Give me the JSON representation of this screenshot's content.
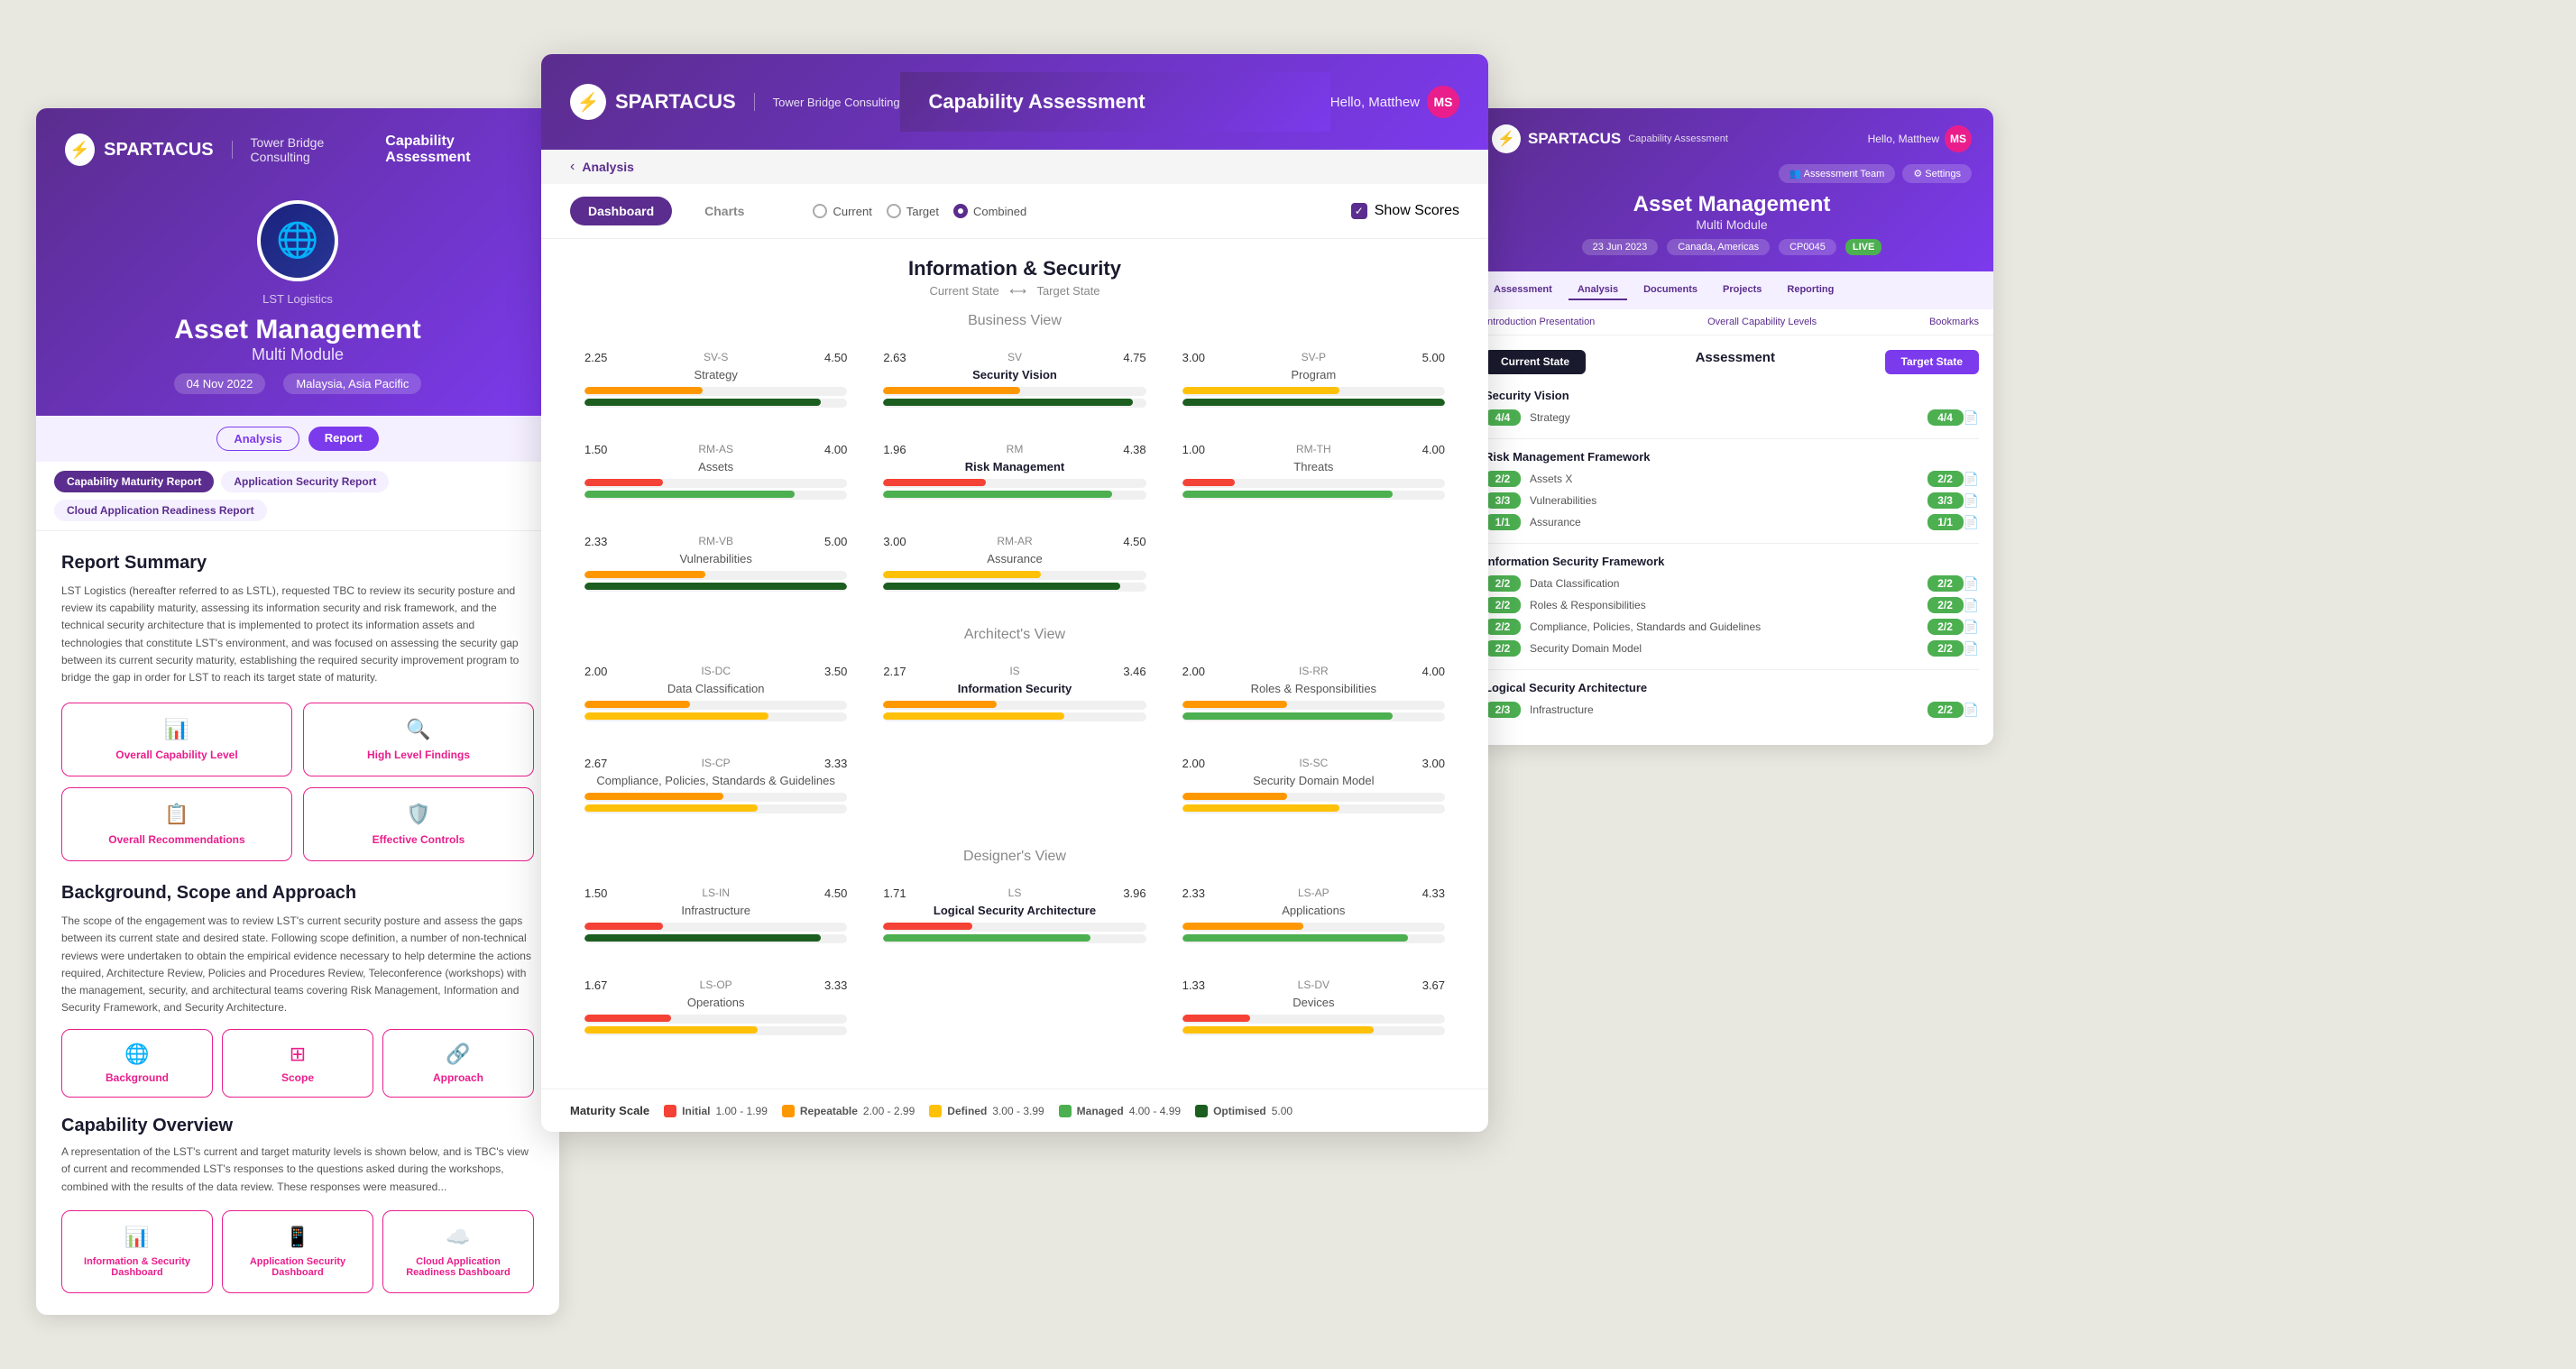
{
  "app": {
    "name": "SPARTACUS",
    "tower_bridge": "Tower Bridge Consulting",
    "cap_assessment": "Capability Assessment",
    "hello": "Hello, Matthew",
    "avatar_initials": "MS"
  },
  "left_panel": {
    "company": "LST Logistics",
    "title": "Asset Management",
    "subtitle": "Multi Module",
    "date": "04 Nov 2022",
    "region": "Malaysia, Asia Pacific",
    "nav": {
      "analysis": "Analysis",
      "report": "Report"
    },
    "tabs": [
      "Capability Maturity Report",
      "Application Security Report",
      "Cloud Application Readiness Report"
    ],
    "report_summary": {
      "title": "Report Summary",
      "text": "LST Logistics (hereafter referred to as LSTL), requested TBC to review its security posture and review its capability maturity, assessing its information security and risk framework, and the technical security architecture that is implemented to protect its information assets and technologies that constitute LST's environment, and was focused on assessing the security gap between its current security maturity, establishing the required security improvement program to bridge the gap in order for LST to reach its target state of maturity."
    },
    "quick_links": [
      {
        "label": "Overall Capability Level",
        "icon": "📊"
      },
      {
        "label": "High Level Findings",
        "icon": "🔍"
      },
      {
        "label": "Overall Recommendations",
        "icon": "📋"
      },
      {
        "label": "Effective Controls",
        "icon": "🛡️"
      }
    ],
    "bg_scope": {
      "title": "Background, Scope and Approach",
      "text": "The scope of the engagement was to review LST's current security posture and assess the gaps between its current state and desired state. Following scope definition, a number of non-technical reviews were undertaken to obtain the empirical evidence necessary to help determine the actions required, Architecture Review, Policies and Procedures Review, Teleconference (workshops) with the management, security, and architectural teams covering Risk Management, Information and Security Framework, and Security Architecture.",
      "links": [
        {
          "label": "Background",
          "icon": "🌐"
        },
        {
          "label": "Scope",
          "icon": "⊞"
        },
        {
          "label": "Approach",
          "icon": "🔗"
        }
      ]
    },
    "capability_overview": {
      "title": "Capability Overview",
      "text": "A representation of the LST's current and target maturity levels is shown below, and is TBC's view of current and recommended LST's responses to the questions asked during the workshops, combined with the results of the data review. These responses were measured...",
      "dash_links": [
        {
          "label": "Information & Security Dashboard",
          "icon": "📊"
        },
        {
          "label": "Application Security Dashboard",
          "icon": "📱"
        },
        {
          "label": "Cloud Application Readiness Dashboard",
          "icon": "☁️"
        }
      ]
    }
  },
  "center_panel": {
    "back_link": "Analysis",
    "tabs": [
      "Dashboard",
      "Charts"
    ],
    "radio_options": [
      "Current",
      "Target",
      "Combined"
    ],
    "selected_radio": "Combined",
    "show_scores_label": "Show Scores",
    "main_title": "Information & Security",
    "main_subtitle_current": "Current State",
    "main_subtitle_target": "Target State",
    "views": [
      {
        "title": "Business View",
        "metrics": [
          {
            "id": "sv-s",
            "label": "SV-S",
            "sublabel": "Strategy",
            "current": 2.25,
            "target": 4.5,
            "current_pct": 45,
            "target_pct": 90,
            "current_color": "orange",
            "target_color": "dark-green"
          },
          {
            "id": "sv",
            "label": "SV",
            "sublabel": "Security Vision",
            "current": 2.63,
            "target": 4.75,
            "current_pct": 52,
            "target_pct": 95,
            "current_color": "orange",
            "target_color": "dark-green",
            "bold": true
          },
          {
            "id": "sv-p",
            "label": "SV-P",
            "sublabel": "Program",
            "current": 3.0,
            "target": 5.0,
            "current_pct": 60,
            "target_pct": 100,
            "current_color": "yellow",
            "target_color": "dark-green"
          },
          {
            "id": "rm-as",
            "label": "RM-AS",
            "sublabel": "Assets",
            "current": 1.5,
            "target": 4.0,
            "current_pct": 30,
            "target_pct": 80,
            "current_color": "red",
            "target_color": "green"
          },
          {
            "id": "rm",
            "label": "RM",
            "sublabel": "Risk Management",
            "current": 1.96,
            "target": 4.38,
            "current_pct": 39,
            "target_pct": 87,
            "current_color": "red",
            "target_color": "green",
            "bold": true
          },
          {
            "id": "rm-th",
            "label": "RM-TH",
            "sublabel": "Threats",
            "current": 1.0,
            "target": 4.0,
            "current_pct": 20,
            "target_pct": 80,
            "current_color": "red",
            "target_color": "green"
          },
          {
            "id": "rm-vb",
            "label": "RM-VB",
            "sublabel": "Vulnerabilities",
            "current": 2.33,
            "target": 5.0,
            "current_pct": 46,
            "target_pct": 100,
            "current_color": "orange",
            "target_color": "dark-green"
          },
          {
            "id": "rm-ar",
            "label": "RM-AR",
            "sublabel": "Assurance",
            "current": 3.0,
            "target": 4.5,
            "current_pct": 60,
            "target_pct": 90,
            "current_color": "yellow",
            "target_color": "dark-green"
          }
        ]
      },
      {
        "title": "Architect's View",
        "metrics": [
          {
            "id": "is-dc",
            "label": "IS-DC",
            "sublabel": "Data Classification",
            "current": 2.0,
            "target": 3.5,
            "current_pct": 40,
            "target_pct": 70,
            "current_color": "orange",
            "target_color": "yellow"
          },
          {
            "id": "is",
            "label": "IS",
            "sublabel": "Information Security",
            "current": 2.17,
            "target": 3.46,
            "current_pct": 43,
            "target_pct": 69,
            "current_color": "orange",
            "target_color": "yellow",
            "bold": true
          },
          {
            "id": "is-rr",
            "label": "IS-RR",
            "sublabel": "Roles & Responsibilities",
            "current": 2.0,
            "target": 4.0,
            "current_pct": 40,
            "target_pct": 80,
            "current_color": "orange",
            "target_color": "green"
          },
          {
            "id": "is-cp",
            "label": "IS-CP",
            "sublabel": "Compliance, Policies, Standards & Guidelines",
            "current": 2.67,
            "target": 3.33,
            "current_pct": 53,
            "target_pct": 66,
            "current_color": "orange",
            "target_color": "yellow"
          },
          {
            "id": "is-sc",
            "label": "IS-SC",
            "sublabel": "Security Domain Model",
            "current": 2.0,
            "target": 3.0,
            "current_pct": 40,
            "target_pct": 60,
            "current_color": "orange",
            "target_color": "yellow"
          }
        ]
      },
      {
        "title": "Designer's View",
        "metrics": [
          {
            "id": "ls-in",
            "label": "LS-IN",
            "sublabel": "Infrastructure",
            "current": 1.5,
            "target": 4.5,
            "current_pct": 30,
            "target_pct": 90,
            "current_color": "red",
            "target_color": "dark-green"
          },
          {
            "id": "ls",
            "label": "LS",
            "sublabel": "Logical Security Architecture",
            "current": 1.71,
            "target": 3.96,
            "current_pct": 34,
            "target_pct": 79,
            "current_color": "red",
            "target_color": "green",
            "bold": true
          },
          {
            "id": "ls-ap",
            "label": "LS-AP",
            "sublabel": "Applications",
            "current": 2.33,
            "target": 4.33,
            "current_pct": 46,
            "target_pct": 86,
            "current_color": "orange",
            "target_color": "green"
          },
          {
            "id": "ls-op",
            "label": "LS-OP",
            "sublabel": "Operations",
            "current": 1.67,
            "target": 3.33,
            "current_pct": 33,
            "target_pct": 66,
            "current_color": "red",
            "target_color": "yellow"
          },
          {
            "id": "ls-dv",
            "label": "LS-DV",
            "sublabel": "Devices",
            "current": 1.33,
            "target": 3.67,
            "current_pct": 26,
            "target_pct": 73,
            "current_color": "red",
            "target_color": "yellow"
          }
        ]
      }
    ],
    "maturity_scale": [
      {
        "label": "Initial",
        "range": "1.00 - 1.99",
        "color": "#f44336"
      },
      {
        "label": "Repeatable",
        "range": "2.00 - 2.99",
        "color": "#ff9800"
      },
      {
        "label": "Defined",
        "range": "3.00 - 3.99",
        "color": "#ffc107"
      },
      {
        "label": "Managed",
        "range": "4.00 - 4.99",
        "color": "#4caf50"
      },
      {
        "label": "Optimised",
        "range": "5.00",
        "color": "#1b5e20"
      }
    ]
  },
  "right_panel": {
    "title": "Asset Management",
    "subtitle": "Multi Module",
    "date": "23 Jun 2023",
    "region": "Canada, Americas",
    "code": "CP0045",
    "live": "LIVE",
    "nav_items": [
      "Assessment",
      "Analysis",
      "Documents",
      "Projects",
      "Reporting"
    ],
    "quick_links": [
      "Introduction Presentation",
      "Overall Capability Levels",
      "Bookmarks"
    ],
    "state_current": "Current State",
    "state_target": "Target State",
    "assess_title": "Assessment",
    "groups": [
      {
        "name": "Security Vision",
        "items": [
          {
            "name": "Strategy",
            "cs": "4/4",
            "ts": "4/4"
          }
        ]
      },
      {
        "name": "Risk Management Framework",
        "items": [
          {
            "name": "Assets X",
            "cs": "2/2",
            "ts": "2/2"
          },
          {
            "name": "Vulnerabilities",
            "cs": "3/3",
            "ts": "3/3"
          },
          {
            "name": "Assurance",
            "cs": "1/1",
            "ts": "1/1"
          }
        ]
      },
      {
        "name": "Information Security Framework",
        "items": [
          {
            "name": "Data Classification",
            "cs": "2/2",
            "ts": "2/2"
          },
          {
            "name": "Roles & Responsibilities",
            "cs": "2/2",
            "ts": "2/2"
          },
          {
            "name": "Compliance, Policies, Standards and Guidelines",
            "cs": "2/2",
            "ts": "2/2"
          },
          {
            "name": "Security Domain Model",
            "cs": "2/2",
            "ts": "2/2"
          }
        ]
      },
      {
        "name": "Logical Security Architecture",
        "items": [
          {
            "name": "Infrastructure",
            "cs": "2/3",
            "ts": "2/2"
          }
        ]
      }
    ]
  }
}
